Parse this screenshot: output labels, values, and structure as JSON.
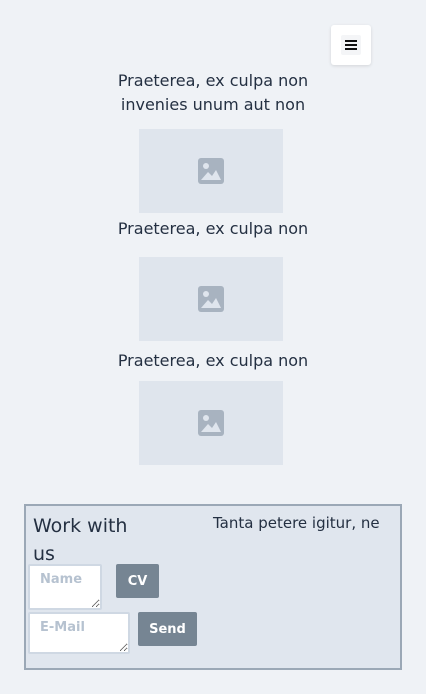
{
  "header": {
    "menu_icon": "hamburger-menu-icon"
  },
  "items": [
    {
      "caption": "Praeterea, ex culpa non invenies unum aut non",
      "image_icon": "image-placeholder-icon"
    },
    {
      "caption": "Praeterea, ex culpa non",
      "image_icon": "image-placeholder-icon"
    },
    {
      "caption": "Praeterea, ex culpa non",
      "image_icon": "image-placeholder-icon"
    }
  ],
  "footer": {
    "title": "Work with us",
    "text": "Tanta petere igitur, ne",
    "name_placeholder": "Name",
    "email_placeholder": "E-Mail",
    "cv_label": "CV",
    "send_label": "Send"
  },
  "colors": {
    "background": "#eff2f6",
    "placeholder_bg": "#dfe5ed",
    "button": "#768593",
    "footer_border": "#9ba8b6"
  }
}
